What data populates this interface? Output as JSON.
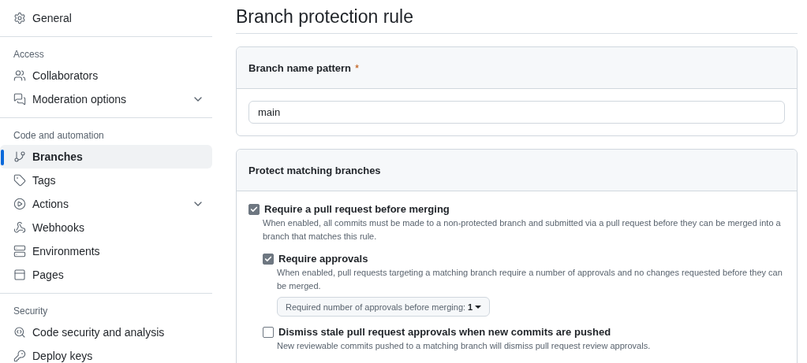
{
  "sidebar": {
    "groups": [
      {
        "items": [
          {
            "label": "General",
            "selected": false,
            "expandable": false
          }
        ]
      },
      {
        "heading": "Access",
        "items": [
          {
            "label": "Collaborators",
            "selected": false,
            "expandable": false
          },
          {
            "label": "Moderation options",
            "selected": false,
            "expandable": true
          }
        ]
      },
      {
        "heading": "Code and automation",
        "items": [
          {
            "label": "Branches",
            "selected": true,
            "expandable": false
          },
          {
            "label": "Tags",
            "selected": false,
            "expandable": false
          },
          {
            "label": "Actions",
            "selected": false,
            "expandable": true
          },
          {
            "label": "Webhooks",
            "selected": false,
            "expandable": false
          },
          {
            "label": "Environments",
            "selected": false,
            "expandable": false
          },
          {
            "label": "Pages",
            "selected": false,
            "expandable": false
          }
        ]
      },
      {
        "heading": "Security",
        "items": [
          {
            "label": "Code security and analysis",
            "selected": false,
            "expandable": false
          },
          {
            "label": "Deploy keys",
            "selected": false,
            "expandable": false
          }
        ]
      }
    ]
  },
  "page_title": "Branch protection rule",
  "pattern_card": {
    "title": "Branch name pattern",
    "required_mark": "*",
    "value": "main"
  },
  "protect_card": {
    "title": "Protect matching branches",
    "rules": [
      {
        "label": "Require a pull request before merging",
        "checked": true,
        "description": "When enabled, all commits must be made to a non-protected branch and submitted via a pull request before they can be merged into a branch that matches this rule.",
        "children": [
          {
            "label": "Require approvals",
            "checked": true,
            "description": "When enabled, pull requests targeting a matching branch require a number of approvals and no changes requested before they can be merged.",
            "dropdown": {
              "label": "Required number of approvals before merging:",
              "value": "1"
            }
          },
          {
            "label": "Dismiss stale pull request approvals when new commits are pushed",
            "checked": false,
            "description": "New reviewable commits pushed to a matching branch will dismiss pull request review approvals."
          }
        ]
      }
    ]
  }
}
